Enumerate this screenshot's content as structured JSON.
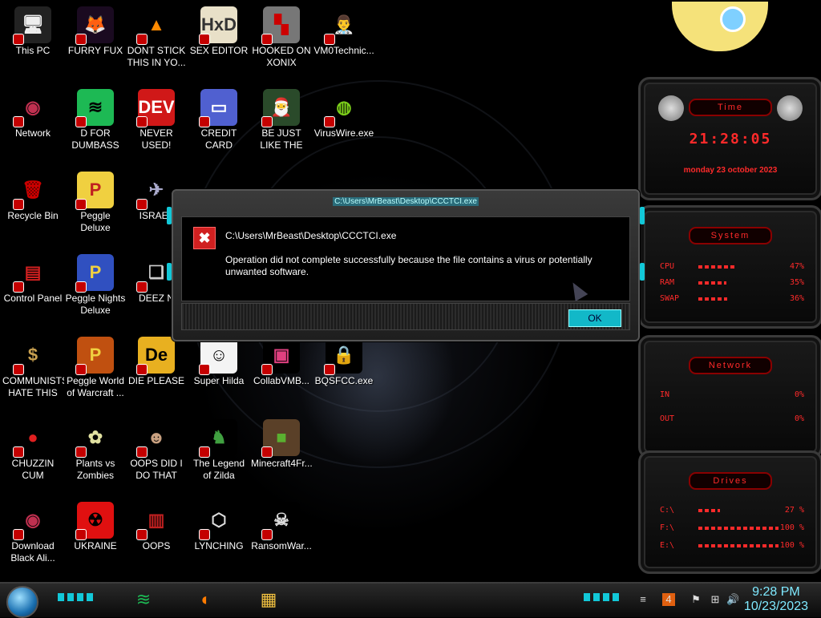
{
  "desktop": {
    "icons": [
      {
        "label": "This PC",
        "glyph": "🖥",
        "bg": "#222",
        "fg": "#eee"
      },
      {
        "label": "FURRY FUX",
        "glyph": "🦊",
        "bg": "#1a0a20",
        "fg": "#ff7b00"
      },
      {
        "label": "DONT STICK THIS IN YO...",
        "glyph": "▲",
        "bg": "#000",
        "fg": "#ff8a00"
      },
      {
        "label": "SEX EDITOR",
        "glyph": "HxD",
        "bg": "#e8e0c8",
        "fg": "#333"
      },
      {
        "label": "HOOKED ON XONIX",
        "glyph": "▚",
        "bg": "#777",
        "fg": "#c00"
      },
      {
        "label": "VM0Technic...",
        "glyph": "👨‍⚕",
        "bg": "#000",
        "fg": "#fff"
      },
      {
        "label": "Network",
        "glyph": "◉",
        "bg": "#000",
        "fg": "#c03050"
      },
      {
        "label": "D FOR DUMBASS",
        "glyph": "≋",
        "bg": "#1db954",
        "fg": "#000"
      },
      {
        "label": "NEVER USED!",
        "glyph": "DEV",
        "bg": "#d01818",
        "fg": "#fff"
      },
      {
        "label": "CREDIT CARD CHECKER",
        "glyph": "▭",
        "bg": "#5060d0",
        "fg": "#fff"
      },
      {
        "label": "BE JUST LIKE THE DUDE!",
        "glyph": "🎅",
        "bg": "#2a4a2a",
        "fg": "#fff"
      },
      {
        "label": "VirusWire.exe",
        "glyph": "◍",
        "bg": "#000",
        "fg": "#7ccf1a"
      },
      {
        "label": "Recycle Bin",
        "glyph": "🗑",
        "bg": "#000",
        "fg": "#c00"
      },
      {
        "label": "Peggle Deluxe",
        "glyph": "P",
        "bg": "#f0d040",
        "fg": "#c02020"
      },
      {
        "label": "ISRAEL",
        "glyph": "✈",
        "bg": "#000",
        "fg": "#aac"
      },
      {
        "label": "Control Panel",
        "glyph": "▤",
        "bg": "#000",
        "fg": "#d02020"
      },
      {
        "label": "Peggle Nights Deluxe",
        "glyph": "P",
        "bg": "#3050c0",
        "fg": "#f0d040"
      },
      {
        "label": "DEEZ N",
        "glyph": "❏",
        "bg": "#000",
        "fg": "#ccc"
      },
      {
        "label": "COMMUNISTS HATE THIS G...",
        "glyph": "$",
        "bg": "#000",
        "fg": "#c8a050"
      },
      {
        "label": "Peggle World of Warcraft ...",
        "glyph": "P",
        "bg": "#c05010",
        "fg": "#f0d040"
      },
      {
        "label": "DIE PLEASE",
        "glyph": "De",
        "bg": "#e8b020",
        "fg": "#000"
      },
      {
        "label": "Super Hilda",
        "glyph": "☺",
        "bg": "#f4f4f4",
        "fg": "#000"
      },
      {
        "label": "CollabVMB...",
        "glyph": "▣",
        "bg": "#000",
        "fg": "#e04080"
      },
      {
        "label": "BQSFCC.exe",
        "glyph": "🔒",
        "bg": "#000",
        "fg": "#e0c020"
      },
      {
        "label": "CHUZZIN CUM",
        "glyph": "●",
        "bg": "#000",
        "fg": "#e02020"
      },
      {
        "label": "Plants vs Zombies",
        "glyph": "✿",
        "bg": "#000",
        "fg": "#e0e0a0"
      },
      {
        "label": "OOPS DID I DO THAT",
        "glyph": "☻",
        "bg": "#000",
        "fg": "#c8a080"
      },
      {
        "label": "The Legend of Zilda",
        "glyph": "♞",
        "bg": "#000",
        "fg": "#40a040"
      },
      {
        "label": "Minecraft4Fr...",
        "glyph": "■",
        "bg": "#5a4028",
        "fg": "#5ab030"
      },
      {
        "label": "Download Black Ali...",
        "glyph": "◉",
        "bg": "#000",
        "fg": "#c03050"
      },
      {
        "label": "UKRAINE",
        "glyph": "☢",
        "bg": "#e01010",
        "fg": "#000"
      },
      {
        "label": "OOPS",
        "glyph": "▥",
        "bg": "#000",
        "fg": "#c02020"
      },
      {
        "label": "LYNCHING",
        "glyph": "⬡",
        "bg": "#000",
        "fg": "#ddd"
      },
      {
        "label": "RansomWar...",
        "glyph": "☠",
        "bg": "#000",
        "fg": "#ddd"
      }
    ]
  },
  "widgets": {
    "time": {
      "title": "Time",
      "clock": "21:28:05",
      "date": "monday 23 october 2023"
    },
    "system": {
      "title": "System",
      "rows": [
        {
          "label": "CPU",
          "value": "47%",
          "fill": 0.47
        },
        {
          "label": "RAM",
          "value": "35%",
          "fill": 0.35
        },
        {
          "label": "SWAP",
          "value": "36%",
          "fill": 0.36
        }
      ]
    },
    "network": {
      "title": "Network",
      "rows": [
        {
          "label": "IN",
          "value": "0%"
        },
        {
          "label": "OUT",
          "value": "0%"
        }
      ]
    },
    "drives": {
      "title": "Drives",
      "rows": [
        {
          "label": "C:\\",
          "value": "27 %",
          "fill": 0.27
        },
        {
          "label": "F:\\",
          "value": "100 %",
          "fill": 1.0
        },
        {
          "label": "E:\\",
          "value": "100 %",
          "fill": 1.0
        }
      ]
    }
  },
  "dialog": {
    "title": "C:\\Users\\MrBeast\\Desktop\\CCCTCI.exe",
    "heading": "C:\\Users\\MrBeast\\Desktop\\CCCTCI.exe",
    "message": "Operation did not complete successfully because the file contains a virus or potentially unwanted software.",
    "ok_label": "OK"
  },
  "taskbar": {
    "time": "9:28 PM",
    "date": "10/23/2023",
    "pinned": [
      {
        "name": "spotify",
        "glyph": "≋",
        "color": "#1db954"
      },
      {
        "name": "firefox",
        "glyph": "◐",
        "color": "#ff7b00"
      },
      {
        "name": "file-explorer",
        "glyph": "▦",
        "color": "#f0c040"
      }
    ]
  },
  "colors": {
    "accent": "#12b8c8",
    "widget_red": "#ff2a2a"
  }
}
